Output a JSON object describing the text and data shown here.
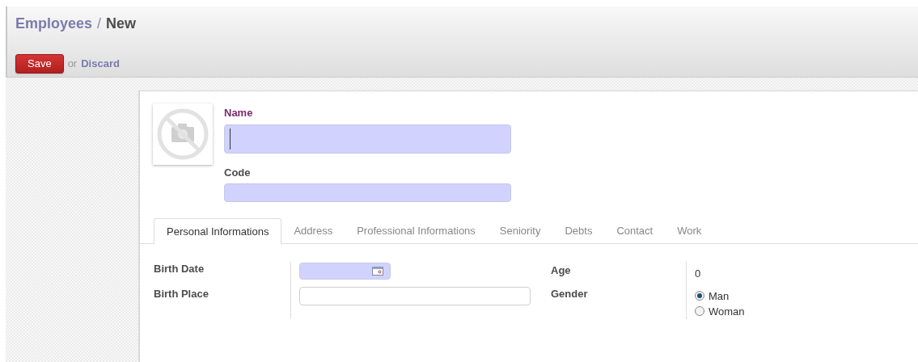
{
  "breadcrumb": {
    "parent": "Employees",
    "separator": "/",
    "current": "New"
  },
  "actions": {
    "save": "Save",
    "or": "or",
    "discard": "Discard"
  },
  "header_fields": [
    {
      "label": "Name",
      "focused": true
    },
    {
      "label": "Code",
      "focused": false
    }
  ],
  "tabs": [
    {
      "label": "Personal Informations",
      "selected": true
    },
    {
      "label": "Address",
      "selected": false
    },
    {
      "label": "Professional Informations",
      "selected": false
    },
    {
      "label": "Seniority",
      "selected": false
    },
    {
      "label": "Debts",
      "selected": false
    },
    {
      "label": "Contact",
      "selected": false
    },
    {
      "label": "Work",
      "selected": false
    }
  ],
  "left_fields": [
    {
      "label": "Birth Date",
      "kind": "date"
    },
    {
      "label": "Birth Place",
      "kind": "text"
    }
  ],
  "right_fields": [
    {
      "label": "Age",
      "kind": "value",
      "value": "0"
    },
    {
      "label": "Gender",
      "kind": "radio",
      "options": [
        {
          "label": "Man",
          "selected": true
        },
        {
          "label": "Woman",
          "selected": false
        }
      ]
    }
  ]
}
